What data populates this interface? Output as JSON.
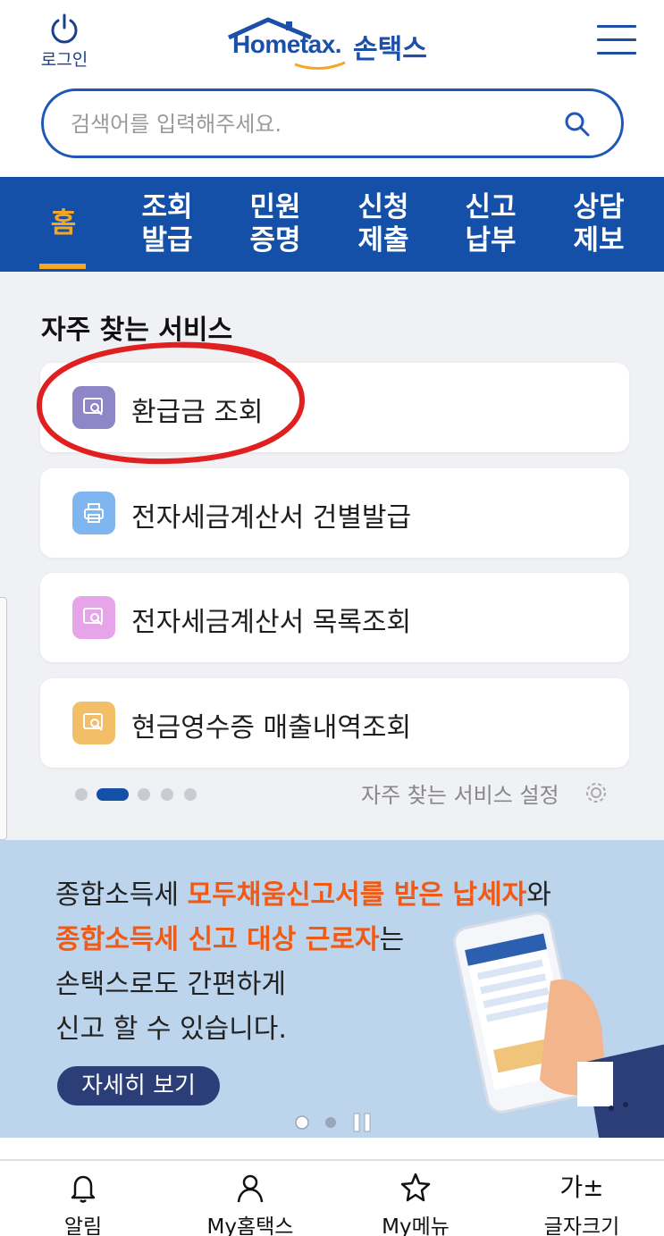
{
  "header": {
    "login_label": "로그인",
    "logo_en": "Hometax.",
    "logo_ko": "손택스"
  },
  "search": {
    "placeholder": "검색어를 입력해주세요."
  },
  "nav": {
    "items": [
      {
        "line1": "홈",
        "line2": ""
      },
      {
        "line1": "조회",
        "line2": "발급"
      },
      {
        "line1": "민원",
        "line2": "증명"
      },
      {
        "line1": "신청",
        "line2": "제출"
      },
      {
        "line1": "신고",
        "line2": "납부"
      },
      {
        "line1": "상담",
        "line2": "제보"
      }
    ],
    "active_index": 0
  },
  "frequent": {
    "title": "자주 찾는 서비스",
    "items": [
      {
        "label": "환급금 조회",
        "icon": "search-document-icon",
        "color": "#8e86c7"
      },
      {
        "label": "전자세금계산서 건별발급",
        "icon": "printer-icon",
        "color": "#7fb6f0"
      },
      {
        "label": "전자세금계산서 목록조회",
        "icon": "search-document-icon",
        "color": "#e6a5e8"
      },
      {
        "label": "현금영수증 매출내역조회",
        "icon": "search-document-icon",
        "color": "#f2bf68"
      }
    ],
    "page_count": 5,
    "active_page": 1,
    "settings_label": "자주 찾는 서비스 설정"
  },
  "banner": {
    "line1_plain": "종합소득세 ",
    "line1_highlight": "모두채움신고서를 받은 납세자",
    "line1_tail": "와",
    "line2_highlight": "종합소득세 신고 대상 근로자",
    "line2_tail": "는",
    "line3": "손택스로도 간편하게",
    "line4": "신고 할 수 있습니다.",
    "button_label": "자세히 보기",
    "slide_count": 2,
    "active_slide": 0
  },
  "bottom_tabs": [
    {
      "label": "알림",
      "icon": "bell-icon"
    },
    {
      "label": "My홈택스",
      "icon": "person-icon"
    },
    {
      "label": "My메뉴",
      "icon": "star-icon"
    },
    {
      "label": "글자크기",
      "icon": "font-size-icon",
      "glyph": "가±"
    }
  ],
  "colors": {
    "brand_blue": "#1550a8",
    "accent_orange": "#f5a623",
    "banner_orange": "#f05a14",
    "annotation_red": "#e02020"
  }
}
